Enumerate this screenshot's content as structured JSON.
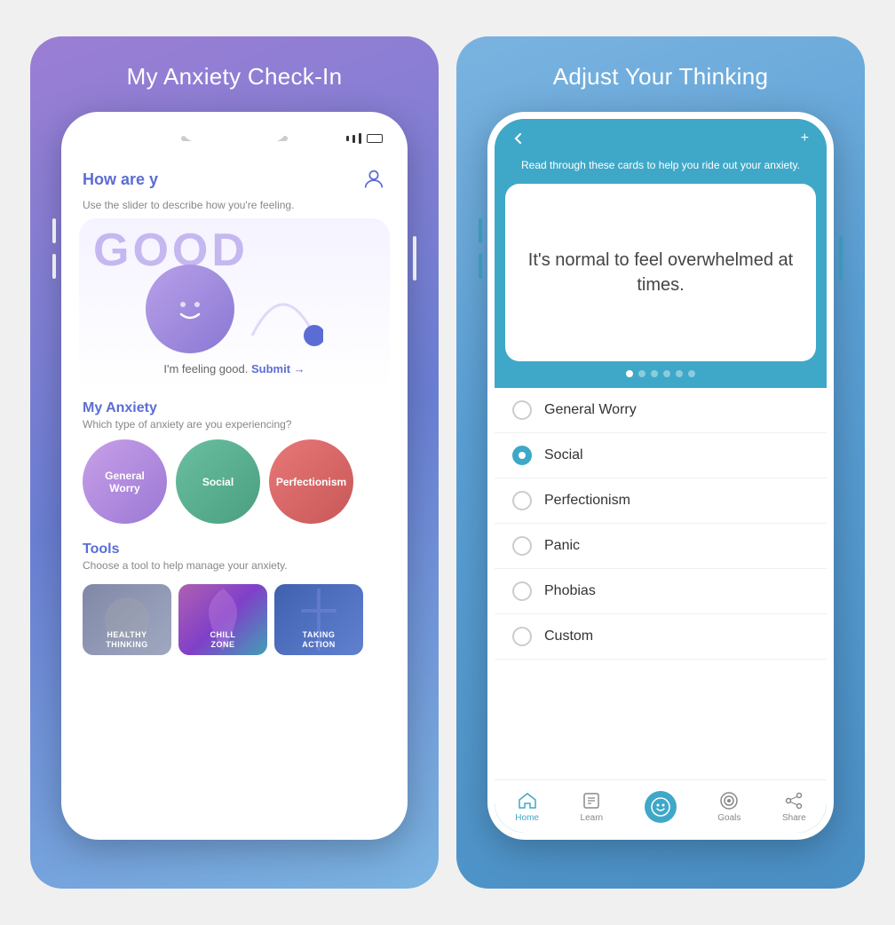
{
  "left_panel": {
    "title": "My Anxiety Check-In",
    "phone": {
      "checkin_title": "How are y",
      "checkin_subtitle": "Use the slider to describe how you're feeling.",
      "mood_word": "GOOD",
      "submit_text": "I'm feeling good.",
      "submit_link": "Submit →",
      "my_anxiety_title": "My Anxiety",
      "my_anxiety_subtitle": "Which type of anxiety are you experiencing?",
      "circles": [
        {
          "label": "General\nWorry",
          "type": "general"
        },
        {
          "label": "Social",
          "type": "social"
        },
        {
          "label": "Perfectionism",
          "type": "perfectionism"
        }
      ],
      "tools_title": "Tools",
      "tools_subtitle": "Choose a tool to help manage your anxiety.",
      "tools": [
        {
          "label": "HEALTHY\nTHINKING",
          "type": "healthy"
        },
        {
          "label": "CHILL\nZONE",
          "type": "chill"
        },
        {
          "label": "TAKING\nACTION",
          "type": "action"
        }
      ]
    }
  },
  "right_panel": {
    "title": "Adjust Your Thinking",
    "phone": {
      "card_subtitle": "Read through these cards to help\nyou ride out your anxiety.",
      "card_text": "It's normal to feel\noverwhelmed at times.",
      "dots_count": 6,
      "active_dot": 0,
      "options": [
        {
          "label": "General Worry",
          "selected": false
        },
        {
          "label": "Social",
          "selected": true
        },
        {
          "label": "Perfectionism",
          "selected": false
        },
        {
          "label": "Panic",
          "selected": false
        },
        {
          "label": "Phobias",
          "selected": false
        },
        {
          "label": "Custom",
          "selected": false
        }
      ],
      "nav_items": [
        {
          "label": "Home",
          "active": true,
          "icon": "home"
        },
        {
          "label": "Learn",
          "active": false,
          "icon": "book"
        },
        {
          "label": "",
          "active": true,
          "icon": "smiley"
        },
        {
          "label": "Goals",
          "active": false,
          "icon": "goals"
        },
        {
          "label": "Share",
          "active": false,
          "icon": "share"
        }
      ]
    }
  }
}
